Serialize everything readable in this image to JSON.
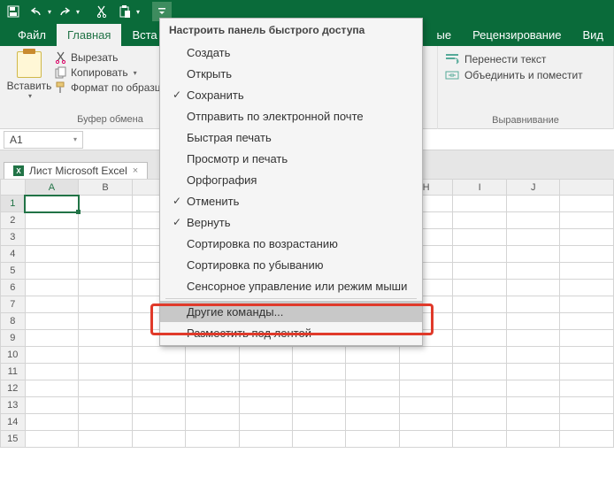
{
  "qat": {
    "dropdown_glyph": "▾"
  },
  "tabs": {
    "file": "Файл",
    "home": "Главная",
    "insert": "Вста",
    "data_stub": "ые",
    "review": "Рецензирование",
    "view": "Вид"
  },
  "ribbon": {
    "paste": "Вставить",
    "cut": "Вырезать",
    "copy": "Копировать",
    "format_painter": "Формат по образц",
    "clipboard_group": "Буфер обмена",
    "wrap": "Перенести текст",
    "merge": "Объединить и поместит",
    "alignment_group": "Выравнивание"
  },
  "namebox": {
    "value": "A1"
  },
  "sheettab": {
    "label": "Лист Microsoft Excel",
    "close": "×"
  },
  "columns": [
    "A",
    "B",
    "",
    "",
    "",
    "",
    "",
    "H",
    "I",
    "J",
    ""
  ],
  "rows": [
    "1",
    "2",
    "3",
    "4",
    "5",
    "6",
    "7",
    "8",
    "9",
    "10",
    "11",
    "12",
    "13",
    "14",
    "15"
  ],
  "menu": {
    "title": "Настроить панель быстрого доступа",
    "items": [
      {
        "label": "Создать",
        "checked": false
      },
      {
        "label": "Открыть",
        "checked": false
      },
      {
        "label": "Сохранить",
        "checked": true
      },
      {
        "label": "Отправить по электронной почте",
        "checked": false
      },
      {
        "label": "Быстрая печать",
        "checked": false
      },
      {
        "label": "Просмотр и печать",
        "checked": false
      },
      {
        "label": "Орфография",
        "checked": false
      },
      {
        "label": "Отменить",
        "checked": true
      },
      {
        "label": "Вернуть",
        "checked": true
      },
      {
        "label": "Сортировка по возрастанию",
        "checked": false
      },
      {
        "label": "Сортировка по убыванию",
        "checked": false
      },
      {
        "label": "Сенсорное управление или режим мыши",
        "checked": false
      },
      {
        "label": "Другие команды...",
        "checked": false,
        "hover": true
      },
      {
        "label": "Разместить под лентой",
        "checked": false
      }
    ],
    "sep_before": 12
  }
}
